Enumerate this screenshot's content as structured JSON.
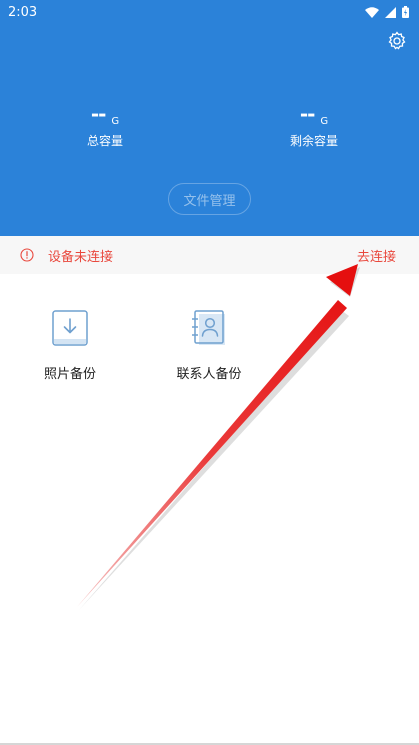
{
  "status_bar": {
    "time": "2:03"
  },
  "header": {
    "total": {
      "value": "--",
      "unit": "G",
      "label": "总容量"
    },
    "remaining": {
      "value": "--",
      "unit": "G",
      "label": "剩余容量"
    },
    "file_manage_label": "文件管理"
  },
  "notice": {
    "message": "设备未连接",
    "action_label": "去连接"
  },
  "tiles": [
    {
      "label": "照片备份",
      "icon": "photo-download-icon"
    },
    {
      "label": "联系人备份",
      "icon": "contact-book-icon"
    }
  ],
  "colors": {
    "header_bg": "#2b82d9",
    "alert_red": "#e9483d",
    "icon_blue": "#6fa0cf",
    "annotation_arrow": "#e81c1c"
  }
}
